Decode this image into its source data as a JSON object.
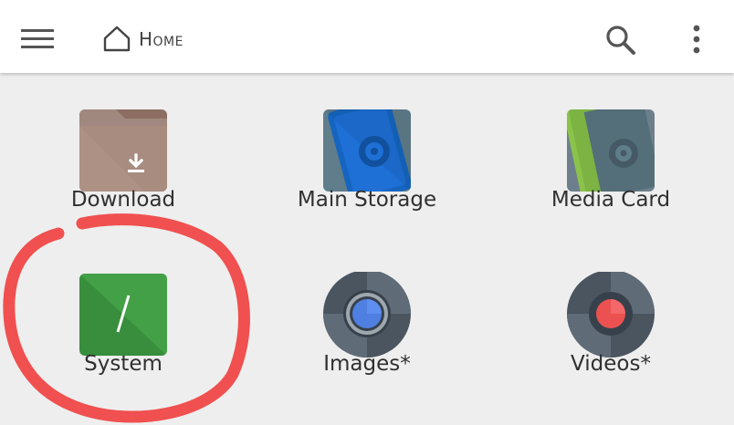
{
  "header": {
    "title": "Home",
    "icons": {
      "menu": "hamburger-menu-icon",
      "home": "home-icon",
      "search": "search-icon",
      "overflow": "more-vertical-icon"
    }
  },
  "items": [
    {
      "label": "Download",
      "icon": "download-folder-icon"
    },
    {
      "label": "Main Storage",
      "icon": "main-storage-icon"
    },
    {
      "label": "Media Card",
      "icon": "media-card-icon"
    },
    {
      "label": "System",
      "icon": "system-root-icon"
    },
    {
      "label": "Images*",
      "icon": "images-lens-icon"
    },
    {
      "label": "Videos*",
      "icon": "videos-lens-icon"
    }
  ],
  "annotation": {
    "color": "#f0504f",
    "target": "System"
  },
  "colors": {
    "appbar": "#ffffff",
    "background": "#eeeeee",
    "download_folder": "#a1887f",
    "main_storage": "#1e6fd6",
    "media_card": "#6d7f8c",
    "system": "#388e3c",
    "images_accent": "#4f7fe0",
    "videos_accent": "#ec5151"
  }
}
